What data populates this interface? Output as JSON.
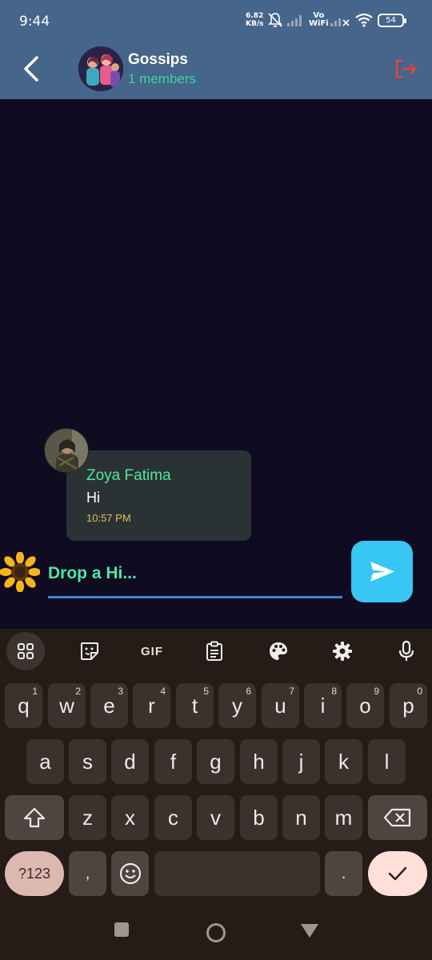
{
  "status_bar": {
    "time": "9:44",
    "net_rate_value": "6.82",
    "net_rate_unit": "KB/s",
    "vowifi_top": "Vo",
    "vowifi_bottom": "WiFi",
    "battery": "54"
  },
  "header": {
    "group_name": "Gossips",
    "member_count": "1 members",
    "accent_color": "#46658a"
  },
  "messages": [
    {
      "sender": "Zoya Fatima",
      "text": "Hi",
      "time": "10:57 PM"
    }
  ],
  "composer": {
    "placeholder": "Drop a Hi..."
  },
  "keyboard": {
    "toolbar": [
      "apps-grid-icon",
      "sticker-icon",
      "GIF",
      "clipboard-icon",
      "palette-icon",
      "gear-icon",
      "mic-icon"
    ],
    "gif_label": "GIF",
    "row1": [
      {
        "k": "q",
        "n": "1"
      },
      {
        "k": "w",
        "n": "2"
      },
      {
        "k": "e",
        "n": "3"
      },
      {
        "k": "r",
        "n": "4"
      },
      {
        "k": "t",
        "n": "5"
      },
      {
        "k": "y",
        "n": "6"
      },
      {
        "k": "u",
        "n": "7"
      },
      {
        "k": "i",
        "n": "8"
      },
      {
        "k": "o",
        "n": "9"
      },
      {
        "k": "p",
        "n": "0"
      }
    ],
    "row2": [
      "a",
      "s",
      "d",
      "f",
      "g",
      "h",
      "j",
      "k",
      "l"
    ],
    "row3": [
      "z",
      "x",
      "c",
      "v",
      "b",
      "n",
      "m"
    ],
    "symbols_label": "?123",
    "comma_label": ",",
    "period_label": "."
  },
  "colors": {
    "chat_bg": "#0f0c22",
    "bubble_bg": "#2b3236",
    "name_green": "#4ee6a2",
    "timestamp": "#d8c25b",
    "send_button": "#38c6f4",
    "leave_icon": "#e0443a"
  }
}
